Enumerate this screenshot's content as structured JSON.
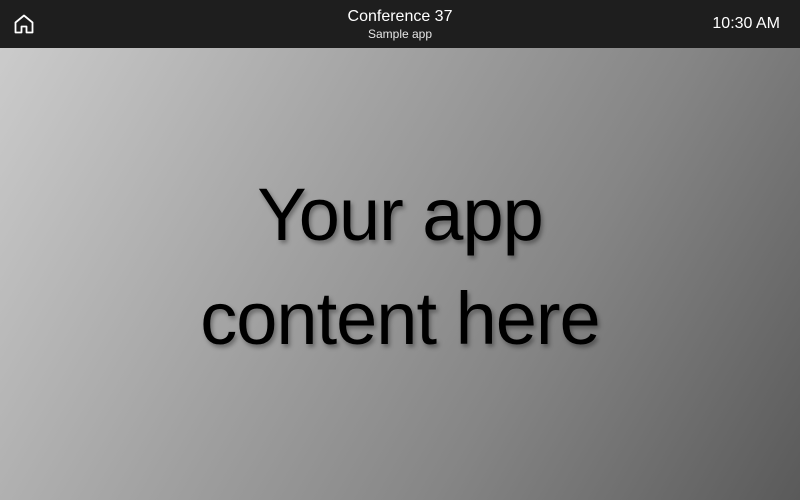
{
  "header": {
    "home_icon": "home-icon",
    "room_name": "Conference 37",
    "app_name": "Sample app",
    "time": "10:30 AM"
  },
  "main": {
    "line1": "Your app",
    "line2": "content here"
  },
  "colors": {
    "topbar_bg": "#1e1e1e",
    "gradient_light": "#cbcbcb",
    "gradient_dark": "#5a5a5a"
  }
}
